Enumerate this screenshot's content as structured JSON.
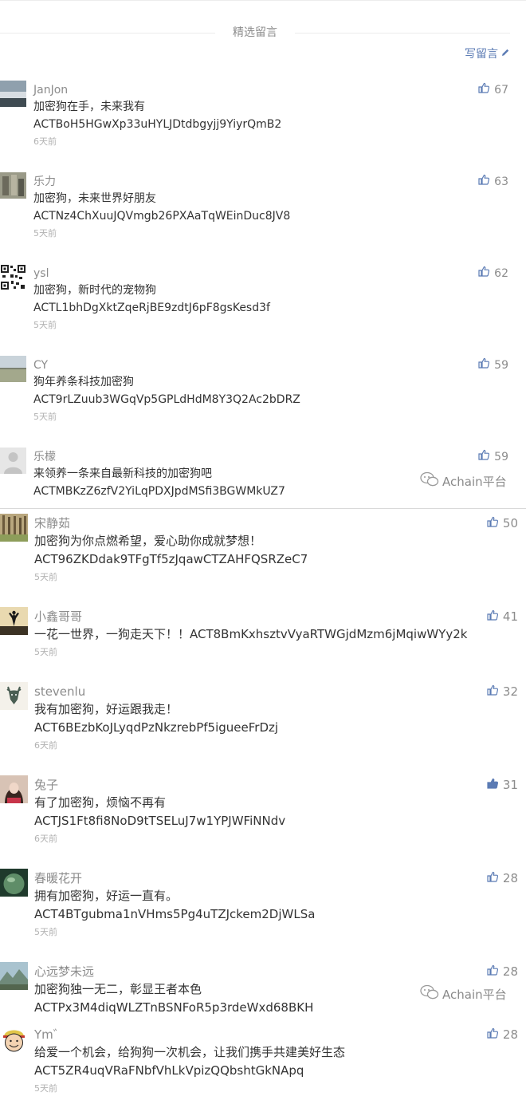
{
  "section": {
    "title": "精选留言",
    "write_label": "写留言"
  },
  "watermark_text": "Achain平台",
  "colors": {
    "link": "#5b7bb4",
    "meta": "#8c8c8c",
    "time": "#b2b2b2",
    "text": "#333333"
  },
  "comments_a": [
    {
      "nick": "JanJon",
      "line1": "加密狗在手，未来我有",
      "line2": "ACTBoH5HGwXp33uHYLJDtdbgyjj9YiyrQmB2",
      "time": "6天前",
      "likes": "67",
      "avatar": "landscape-photo"
    },
    {
      "nick": "乐力",
      "line1": "加密狗，未来世界好朋友",
      "line2": "ACTNz4ChXuuJQVmgb26PXAaTqWEinDuc8JV8",
      "time": "5天前",
      "likes": "63",
      "avatar": "rock-photo"
    },
    {
      "nick": "ysl",
      "line1": "加密狗，新时代的宠物狗",
      "line2": "ACTL1bhDgXktZqeRjBE9zdtJ6pF8gsKesd3f",
      "time": "5天前",
      "likes": "62",
      "avatar": "qr-code"
    },
    {
      "nick": "CY",
      "line1": "狗年养条科技加密狗",
      "line2": "ACT9rLZuub3WGqVp5GPLdHdM8Y3Q2Ac2bDRZ",
      "time": "5天前",
      "likes": "59",
      "avatar": "field-photo"
    },
    {
      "nick": "乐檬",
      "line1": "来领养一条来自最新科技的加密狗吧",
      "line2": "ACTMBKzZ6zfV2YiLqPDXJpdMSfi3BGWMkUZ7",
      "time": "",
      "likes": "59",
      "avatar": "default-person"
    }
  ],
  "comments_b": [
    {
      "nick": "宋静茹",
      "line1": "加密狗为你点燃希望，爱心助你成就梦想！",
      "line2": "ACT96ZKDdak9TFgTf5zJqawCTZAHFQSRZeC7",
      "time": "5天前",
      "likes": "50",
      "avatar": "trees-photo"
    },
    {
      "nick": "小鑫哥哥",
      "line1": "一花一世界，一狗走天下！！ACT8BmKxhsztvVyaRTWGjdMzm6jMqiwWYy2k",
      "line2": "",
      "time": "5天前",
      "likes": "41",
      "avatar": "sunset-silhouette"
    },
    {
      "nick": "stevenlu",
      "line1": "我有加密狗，好运跟我走！",
      "line2": "ACT6BEzbKoJLyqdPzNkzrebPf5igueeFrDzj",
      "time": "6天前",
      "likes": "32",
      "avatar": "deer-logo"
    },
    {
      "nick": "兔子",
      "line1": "有了加密狗，烦恼不再有",
      "line2": "ACTJS1Ft8fi8NoD9tTSELuJ7w1YPJWFiNNdv",
      "time": "6天前",
      "likes": "31",
      "avatar": "girl-photo"
    },
    {
      "nick": "春暖花开",
      "line1": "拥有加密狗，好运一直有。",
      "line2": "ACT4BTgubma1nVHms5Pg4uTZJckem2DjWLSa",
      "time": "5天前",
      "likes": "28",
      "avatar": "sphere-photo"
    },
    {
      "nick": "心远梦未远",
      "line1": "加密狗独一无二，彰显王者本色",
      "line2": "ACTPx3M4diqWLZTnBSNFoR5p3rdeWxd68BKH",
      "time": "",
      "likes": "28",
      "avatar": "mountain-photo"
    },
    {
      "nick": "Ym゛",
      "line1": "给爱一个机会，给狗狗一次机会，让我们携手共建美好生态",
      "line2": "ACT5ZR4uqVRaFNbfVhLkVpizQQbshtGkNApq",
      "time": "5天前",
      "likes": "28",
      "avatar": "cartoon-face"
    }
  ]
}
